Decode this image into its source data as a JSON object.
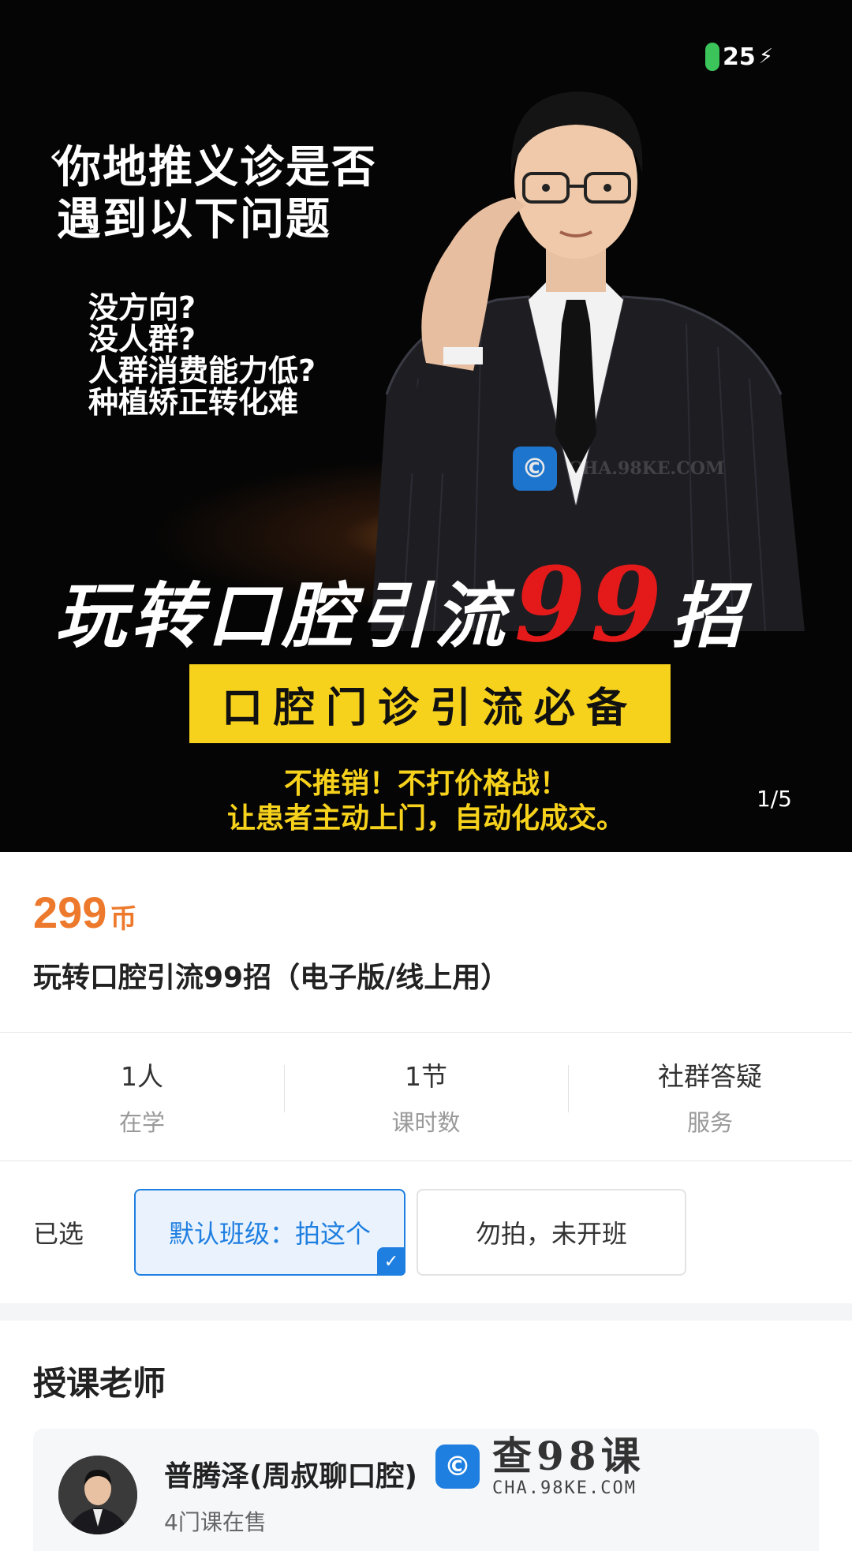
{
  "status": {
    "battery": "25"
  },
  "banner": {
    "headline_line1": "你地推义诊是否",
    "headline_line2": "遇到以下问题",
    "questions": [
      "没方向?",
      "没人群?",
      "人群消费能力低?",
      "种植矫正转化难"
    ],
    "title_prefix": "玩转口腔引流",
    "title_number": "99",
    "title_suffix": "招",
    "yellow_bar": "口腔门诊引流必备",
    "tagline_line1": "不推销！不打价格战！",
    "tagline_line2": "让患者主动上门，自动化成交。",
    "page_indicator": "1/5",
    "watermark_url": "CHA.98KE.COM"
  },
  "product": {
    "price": "299",
    "price_unit": "币",
    "title": "玩转口腔引流99招（电子版/线上用）"
  },
  "stats": [
    {
      "value": "1人",
      "label": "在学"
    },
    {
      "value": "1节",
      "label": "课时数"
    },
    {
      "value": "社群答疑",
      "label": "服务"
    }
  ],
  "selection": {
    "label": "已选",
    "options": [
      "默认班级：拍这个",
      "勿拍，未开班"
    ]
  },
  "teacher": {
    "heading": "授课老师",
    "name": "普腾泽(周叔聊口腔)",
    "courses": "4门课在售"
  },
  "watermark": {
    "brand": "查98课",
    "url": "CHA.98KE.COM"
  },
  "colors": {
    "accent_blue": "#1f7fe0",
    "price_orange": "#ed7a2c",
    "banner_yellow": "#f7d21c",
    "title_red": "#e41a1a"
  }
}
